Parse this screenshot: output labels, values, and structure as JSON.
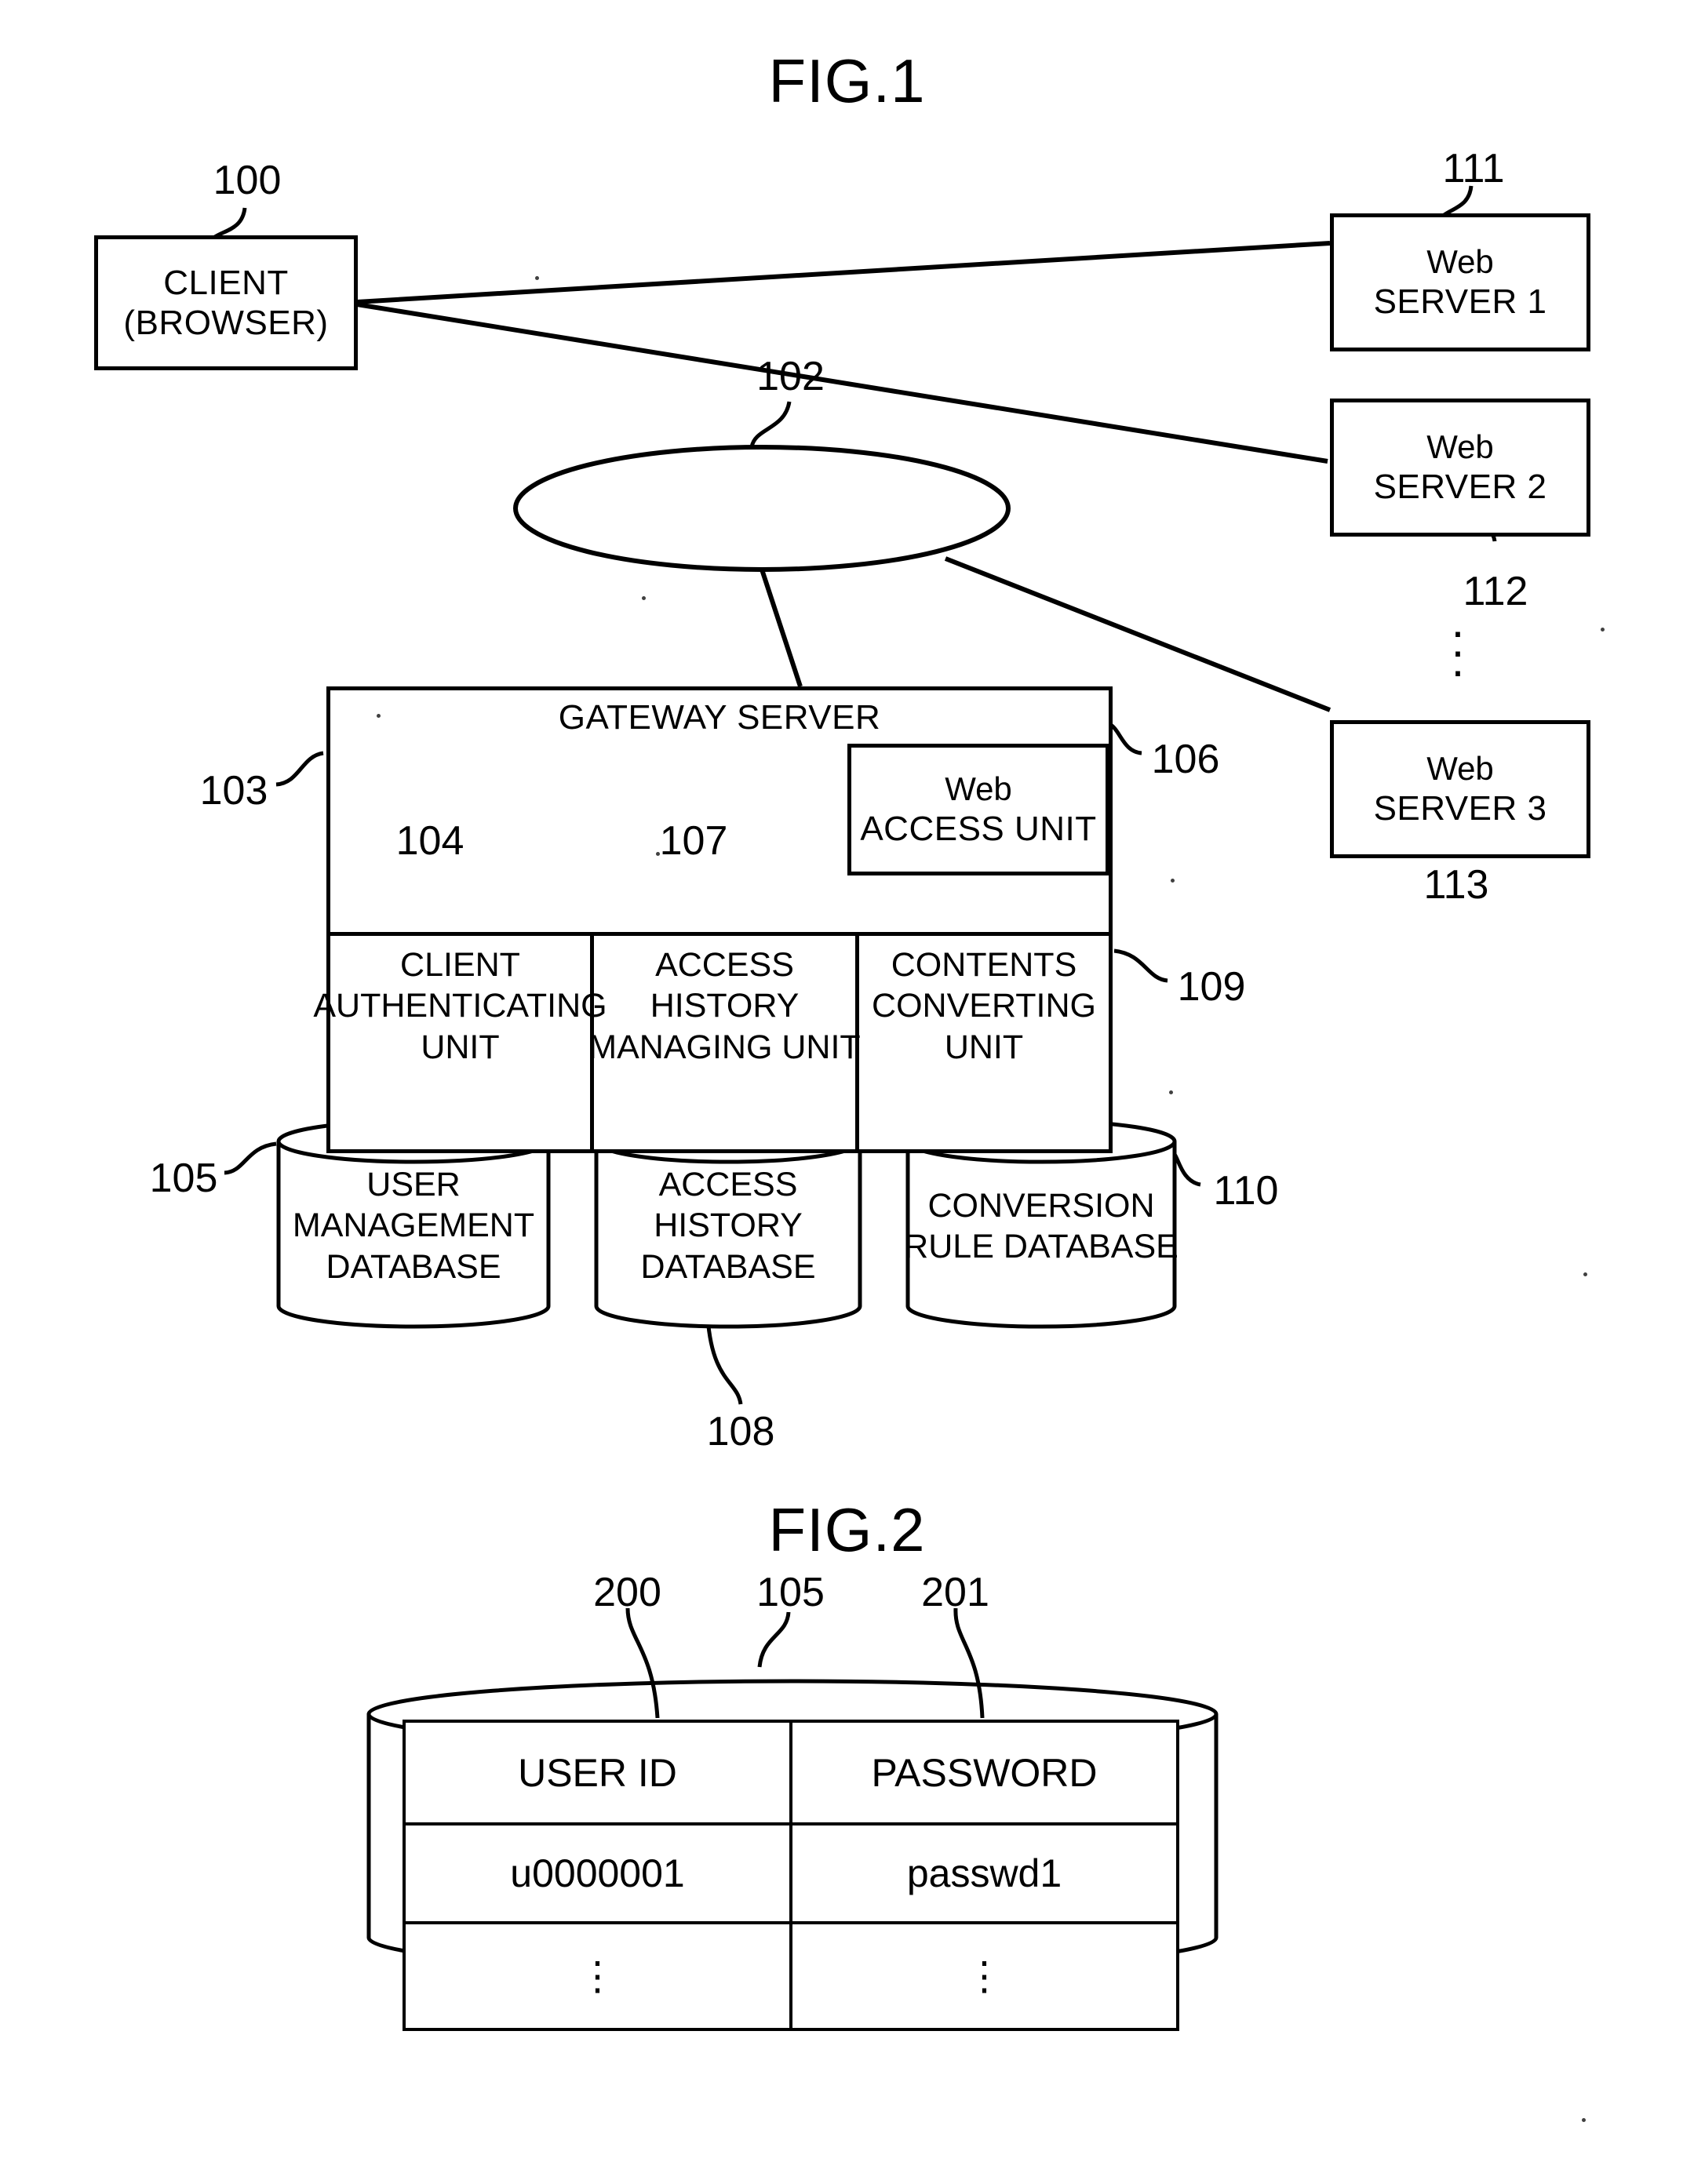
{
  "figures": [
    {
      "title": "FIG.1"
    },
    {
      "title": "FIG.2"
    }
  ],
  "fig1": {
    "client": {
      "line1": "CLIENT",
      "line2": "(BROWSER)",
      "ref": "100"
    },
    "network": {
      "ref": "102"
    },
    "web_servers": [
      {
        "top": "Web",
        "bottom": "SERVER 1",
        "ref": "111"
      },
      {
        "top": "Web",
        "bottom": "SERVER 2",
        "ref": "112"
      },
      {
        "top": "Web",
        "bottom": "SERVER 3",
        "ref": "113"
      }
    ],
    "server_ellipsis": "⋮",
    "gateway": {
      "title": "GATEWAY SERVER",
      "ref": "103",
      "web_access_unit": {
        "line1": "Web",
        "line2": "ACCESS UNIT",
        "ref": "106"
      },
      "units": [
        {
          "line1": "CLIENT",
          "line2": "AUTHENTICATING",
          "line3": "UNIT",
          "ref": "104"
        },
        {
          "line1": "ACCESS",
          "line2": "HISTORY",
          "line3": "MANAGING UNIT",
          "ref": "107"
        },
        {
          "line1": "CONTENTS",
          "line2": "CONVERTING",
          "line3": "UNIT",
          "ref": "109"
        }
      ]
    },
    "databases": [
      {
        "line1": "USER",
        "line2": "MANAGEMENT",
        "line3": "DATABASE",
        "ref": "105"
      },
      {
        "line1": "ACCESS",
        "line2": "HISTORY",
        "line3": "DATABASE",
        "ref": "108"
      },
      {
        "line1": "CONVERSION",
        "line2": "RULE DATABASE",
        "ref": "110"
      }
    ]
  },
  "fig2": {
    "database_ref": "105",
    "column_refs": {
      "user_id": "200",
      "password": "201"
    },
    "table": {
      "headers": [
        "USER ID",
        "PASSWORD"
      ],
      "rows": [
        [
          "u0000001",
          "passwd1"
        ],
        [
          "⋮",
          "⋮"
        ]
      ]
    }
  },
  "style": {
    "ink": "#000000",
    "paper": "#ffffff"
  }
}
